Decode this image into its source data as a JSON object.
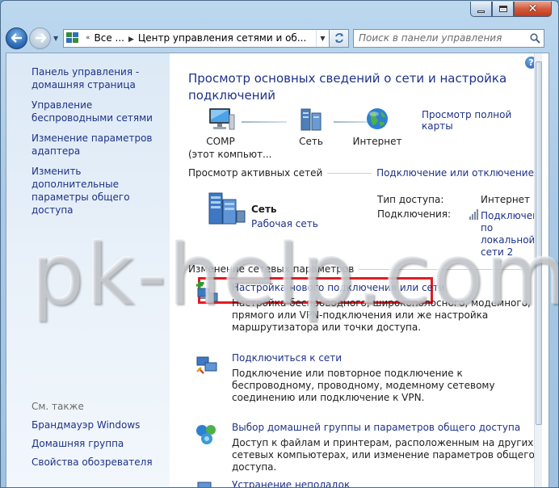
{
  "window": {
    "minimize_glyph": "–",
    "maximize_glyph": "□",
    "close_glyph": "✕"
  },
  "navbar": {
    "back_icon": "back-arrow-icon",
    "forward_icon": "forward-arrow-icon",
    "address": {
      "part1": "Все ...",
      "part2": "Центр управления сетями и об..."
    },
    "search_placeholder": "Поиск в панели управления"
  },
  "sidebar": {
    "items": [
      {
        "label": "Панель управления - домашняя страница"
      },
      {
        "label": "Управление беспроводными сетями"
      },
      {
        "label": "Изменение параметров адаптера"
      },
      {
        "label": "Изменить дополнительные параметры общего доступа"
      }
    ],
    "see_also_label": "См. также",
    "see_also": [
      {
        "label": "Брандмауэр Windows"
      },
      {
        "label": "Домашняя группа"
      },
      {
        "label": "Свойства обозревателя"
      }
    ]
  },
  "main": {
    "help_glyph": "?",
    "title": "Просмотр основных сведений о сети и настройка подключений",
    "full_map_link": "Просмотр полной карты",
    "map": {
      "computer_name": "COMP",
      "computer_sub": "(этот компьют...",
      "network": "Сеть",
      "internet": "Интернет"
    },
    "active_networks": {
      "label": "Просмотр активных сетей",
      "link": "Подключение или отключение",
      "net_name": "Сеть",
      "net_type": "Рабочая сеть",
      "access_type_label": "Тип доступа:",
      "access_type_value": "Интернет",
      "connections_label": "Подключения:",
      "connection_link": "Подключение по локальной сети 2"
    },
    "change_settings": {
      "label": "Изменение сетевых параметров",
      "tasks": [
        {
          "title": "Настройка нового подключения или сети",
          "desc": "Настройка беспроводного, широкополосного, модемного, прямого или VPN-подключения или же настройка маршрутизатора или точки доступа."
        },
        {
          "title": "Подключиться к сети",
          "desc": "Подключение или повторное подключение к беспроводному, проводному, модемному сетевому соединению или подключение к VPN."
        },
        {
          "title": "Выбор домашней группы и параметров общего доступа",
          "desc": "Доступ к файлам и принтерам, расположенным на других сетевых компьютерах, или изменение параметров общего доступа."
        },
        {
          "title": "Устранение неполадок",
          "desc": ""
        }
      ]
    }
  },
  "watermark": "pk-help.com",
  "colors": {
    "link": "#1e3287",
    "highlight_border": "#e31b23",
    "sidebar_bg": "#dce9f6"
  }
}
